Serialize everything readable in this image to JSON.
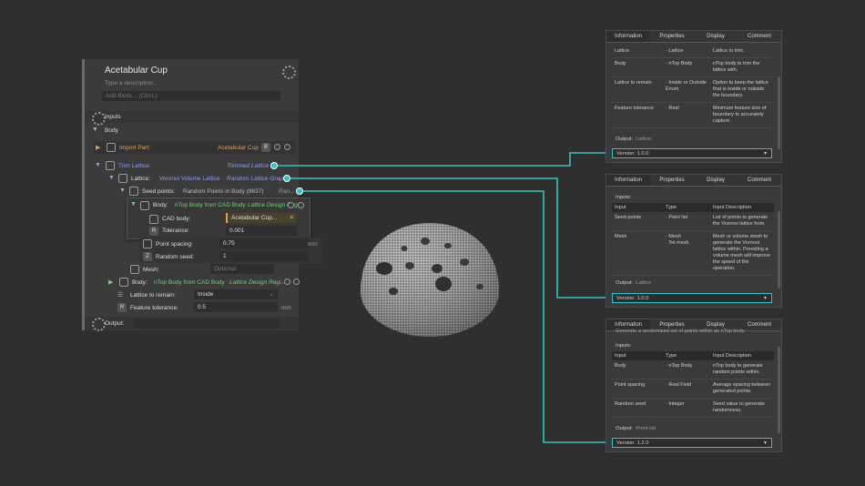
{
  "panel": {
    "title": "Acetabular Cup",
    "description_placeholder": "Type a description...",
    "add_block_placeholder": "Add Block... (Ctrl-L)",
    "inputs_label": "Inputs",
    "body_label": "Body",
    "output_label": "Output:"
  },
  "import_part": {
    "label": "Import Part:",
    "value": "Acetabular Cup",
    "badge": "B"
  },
  "trim_lattice": {
    "label": "Trim Lattice:",
    "value": "Trimmed Lattice"
  },
  "voronoi": {
    "label": "Lattice:",
    "type": "Voronoi Volume Lattice",
    "value": "Random Lattice Graph"
  },
  "seed": {
    "label": "Seed points:",
    "type": "Random Points in Body (8637)",
    "value": "Ran..."
  },
  "cad_node": {
    "body_label": "Body:",
    "body_type": "nTop Body from CAD Body",
    "body_value": "Lattice Design Regi...",
    "cad_label": "CAD body:",
    "cad_value": "Acetabular Cup...",
    "tol_badge": "R",
    "tol_label": "Tolerance:",
    "tol_value": "0.001"
  },
  "point_spacing": {
    "label": "Point spacing:",
    "value": "0.75",
    "unit": "mm"
  },
  "random_seed": {
    "badge": "Z",
    "label": "Random seed:",
    "value": "1"
  },
  "mesh": {
    "label": "Mesh:",
    "value": "Optional"
  },
  "body2": {
    "label": "Body:",
    "type": "nTop Body from CAD Body",
    "value": "Lattice Design Regi..."
  },
  "lattice_remain": {
    "label": "Lattice to remain:",
    "value": "Inside"
  },
  "feature_tol": {
    "badge": "R",
    "label": "Feature tolerance:",
    "value": "0.5",
    "unit": "mm"
  },
  "doc_tabs": [
    "Information",
    "Properties",
    "Display",
    "Comment"
  ],
  "doc1": {
    "rows": [
      [
        "Lattice",
        "· Lattice",
        "Lattice to trim."
      ],
      [
        "Body",
        "· nTop Body",
        "nTop body to trim the lattice with."
      ],
      [
        "Lattice to remain",
        "· Inside or Outside Enum",
        "Option to keep the lattice that is inside or outside the boundary."
      ],
      [
        "Feature tolerance",
        "· Real",
        "Minimum feature size of boundary to accurately capture."
      ]
    ],
    "output_label": "Output:",
    "output_value": "Lattice",
    "version_label": "Version:",
    "version_value": "1.0.0"
  },
  "doc2": {
    "inputs_label": "Inputs:",
    "headers": [
      "Input",
      "Type",
      "Input Description"
    ],
    "rows": [
      [
        "Seed points",
        "· Point list",
        "List of points to generate the Voronoi lattice from."
      ],
      [
        "Mesh",
        "· Mesh\n· Tet mesh",
        "Mesh or volume mesh to generate the Voronoi lattice within. Providing a volume mesh will improve the speed of the operation."
      ]
    ],
    "output_label": "Output:",
    "output_value": "Lattice",
    "version_label": "Version:",
    "version_value": "1.0.0"
  },
  "doc3": {
    "intro": "Generate a randomized set of points within an nTop body.",
    "inputs_label": "Inputs:",
    "headers": [
      "Input",
      "Type",
      "Input Description"
    ],
    "rows": [
      [
        "Body",
        "· nTop Body",
        "nTop body to generate random points within."
      ],
      [
        "Point spacing",
        "· Real Field",
        "Average spacing between generated points."
      ],
      [
        "Random seed",
        "· Integer",
        "Seed value to generate randomness."
      ]
    ],
    "output_label": "Output:",
    "output_value": "Point list",
    "version_label": "Version:",
    "version_value": "1.2.0"
  },
  "colors": {
    "wire": "#2ec4c4",
    "accent_green": "#6fd27a",
    "accent_orange": "#e0a040",
    "accent_blue": "#8a9cff"
  }
}
